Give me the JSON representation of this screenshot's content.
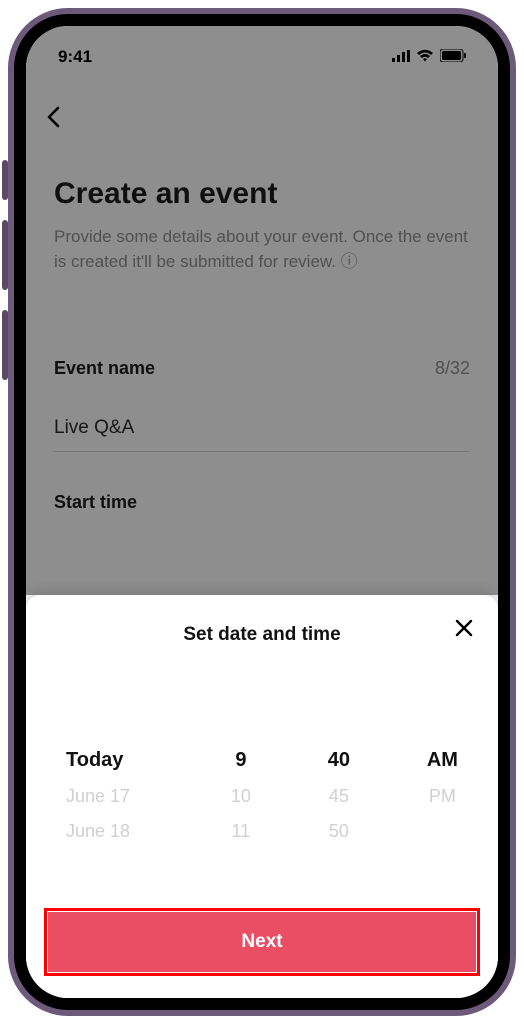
{
  "status": {
    "time": "9:41"
  },
  "page": {
    "title": "Create an event",
    "subtitle_1": "Provide some details about your event. Once the event is created it'll be submitted for review.",
    "event_name_label": "Event name",
    "counter": "8/32",
    "event_name_value": "Live Q&A",
    "start_time_label": "Start time"
  },
  "sheet": {
    "title": "Set date and time",
    "next_label": "Next",
    "picker": {
      "date_selected": "Today",
      "date_next1": "June 17",
      "date_next2": "June 18",
      "hour_selected": "9",
      "hour_next1": "10",
      "hour_next2": "11",
      "minute_selected": "40",
      "minute_next1": "45",
      "minute_next2": "50",
      "period_selected": "AM",
      "period_next1": "PM"
    }
  }
}
